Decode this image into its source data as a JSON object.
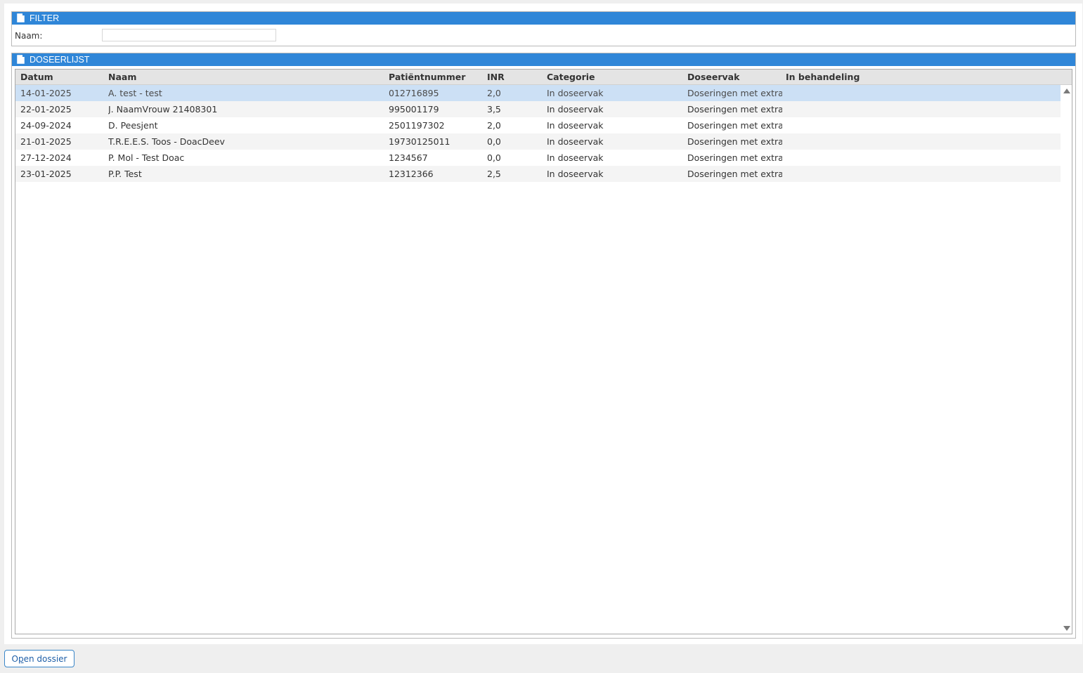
{
  "filter": {
    "title": "FILTER",
    "name_label": "Naam:",
    "name_value": ""
  },
  "list": {
    "title": "DOSEERLIJST",
    "columns": [
      "Datum",
      "Naam",
      "Patiëntnummer",
      "INR",
      "Categorie",
      "Doseervak",
      "In behandeling"
    ],
    "rows": [
      {
        "datum": "14-01-2025",
        "naam": "A. test - test",
        "patientnummer": "012716895",
        "inr": "2,0",
        "categorie": "In doseervak",
        "doseervak": "Doseringen met extra a",
        "in_behandeling": "",
        "selected": true
      },
      {
        "datum": "22-01-2025",
        "naam": "J. NaamVrouw 21408301",
        "patientnummer": "995001179",
        "inr": "3,5",
        "categorie": "In doseervak",
        "doseervak": "Doseringen met extra a",
        "in_behandeling": ""
      },
      {
        "datum": "24-09-2024",
        "naam": "D. Peesjent",
        "patientnummer": "2501197302",
        "inr": "2,0",
        "categorie": "In doseervak",
        "doseervak": "Doseringen met extra a",
        "in_behandeling": ""
      },
      {
        "datum": "21-01-2025",
        "naam": "T.R.E.E.S. Toos - DoacDeev",
        "patientnummer": "19730125011",
        "inr": "0,0",
        "categorie": "In doseervak",
        "doseervak": "Doseringen met extra a",
        "in_behandeling": ""
      },
      {
        "datum": "27-12-2024",
        "naam": "P. Mol - Test Doac",
        "patientnummer": "1234567",
        "inr": "0,0",
        "categorie": "In doseervak",
        "doseervak": "Doseringen met extra a",
        "in_behandeling": ""
      },
      {
        "datum": "23-01-2025",
        "naam": "P.P. Test",
        "patientnummer": "12312366",
        "inr": "2,5",
        "categorie": "In doseervak",
        "doseervak": "Doseringen met extra a",
        "in_behandeling": ""
      }
    ]
  },
  "actions": {
    "open_dossier_prefix": "O",
    "open_dossier_underlined": "p",
    "open_dossier_suffix": "en dossier"
  },
  "icons": {
    "panel_header": "document-icon",
    "scroll_up": "scroll-up-arrow-icon",
    "scroll_down": "scroll-down-arrow-icon"
  },
  "colors": {
    "header_blue": "#2f86d8",
    "selected_row": "#cce0f5",
    "button_border": "#3a86c8"
  }
}
